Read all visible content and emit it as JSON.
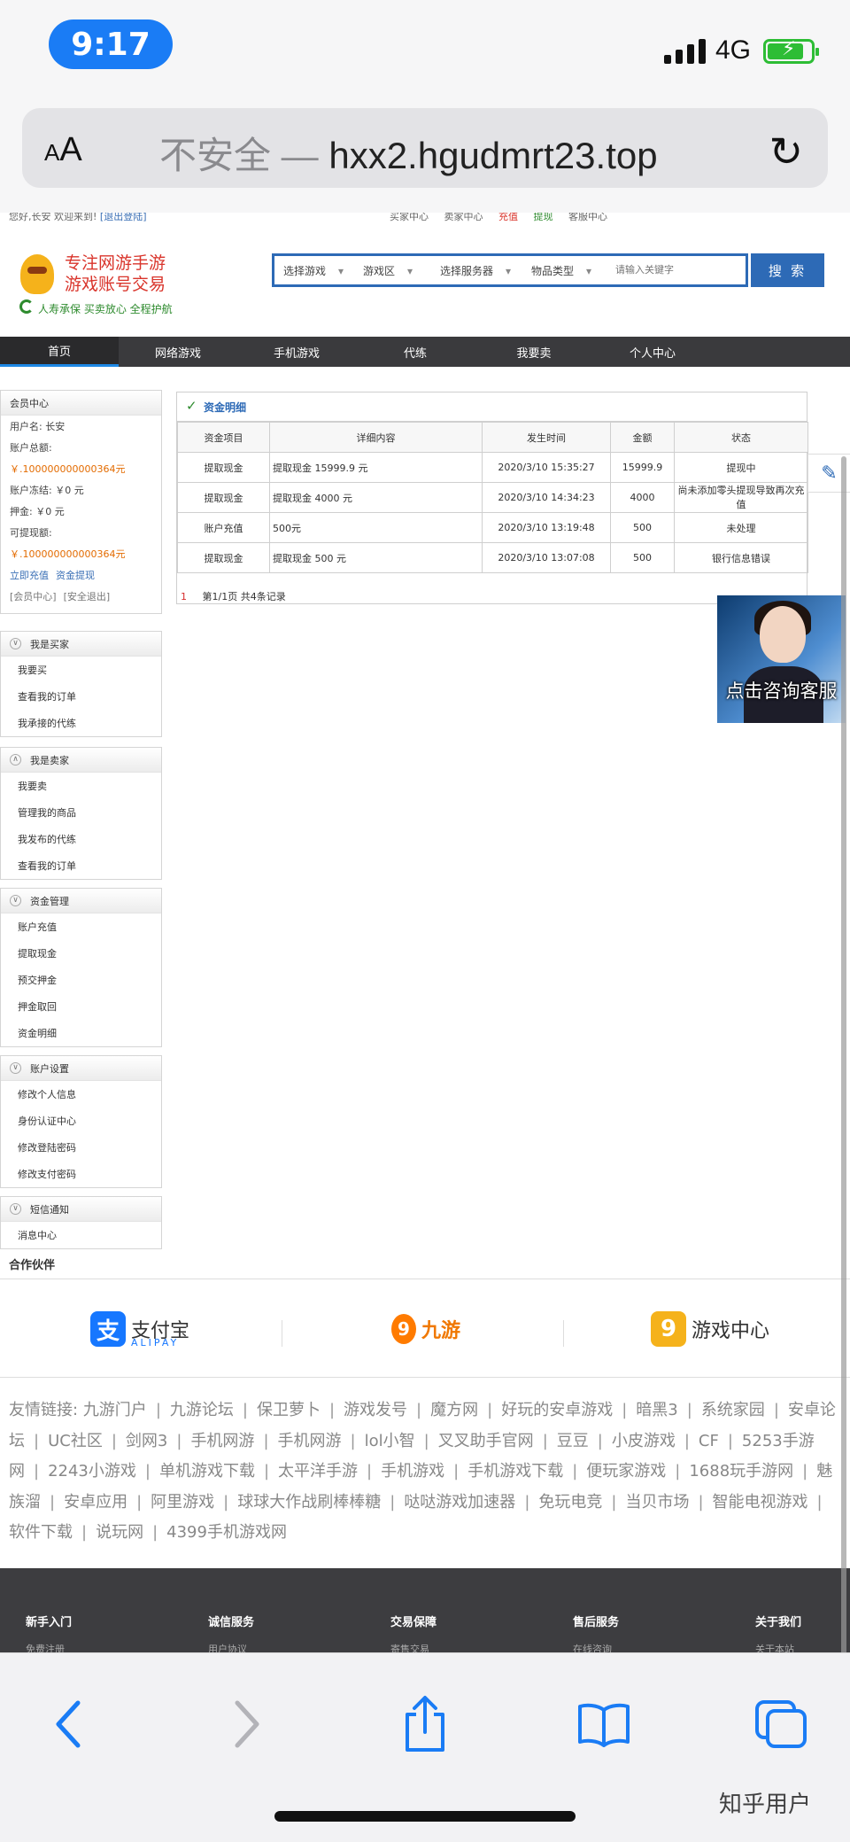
{
  "status_bar": {
    "time": "9:17",
    "network": "4G"
  },
  "address_bar": {
    "aa": "AA",
    "insecure": "不安全 —",
    "domain": "hxx2.hgudmrt23.top"
  },
  "site": {
    "topbar": {
      "greeting": "您好,长安 欢迎来到!",
      "logout": "[退出登陆]",
      "links": [
        "买家中心",
        "卖家中心",
        "充值",
        "提现",
        "客服中心"
      ]
    },
    "logo": {
      "line1": "专注网游手游",
      "line2": "游戏账号交易",
      "slogan": "人寿承保  买卖放心  全程护航"
    },
    "search": {
      "selects": [
        "选择游戏",
        "游戏区",
        "选择服务器",
        "物品类型"
      ],
      "placeholder": "请输入关键字",
      "button": "搜 索"
    },
    "nav": [
      "首页",
      "网络游戏",
      "手机游戏",
      "代练",
      "我要卖",
      "个人中心"
    ],
    "member": {
      "title": "会员中心",
      "username": "用户名: 长安",
      "balance_label": "账户总额:",
      "balance_value": "￥.100000000000364元",
      "frozen": "账户冻结: ￥0 元",
      "deposit": "押金: ￥0 元",
      "withdrawable_label": "可提现额:",
      "withdrawable_value": "￥.100000000000364元",
      "recharge": "立即充值",
      "withdraw": "资金提现",
      "member_center": "[会员中心]",
      "safe_exit": "[安全退出]"
    },
    "panels": [
      {
        "title": "我是买家",
        "items": [
          "我要买",
          "查看我的订单",
          "我承接的代练"
        ]
      },
      {
        "title": "我是卖家",
        "items": [
          "我要卖",
          "管理我的商品",
          "我发布的代练",
          "查看我的订单"
        ]
      },
      {
        "title": "资金管理",
        "items": [
          "账户充值",
          "提取现金",
          "预交押金",
          "押金取回",
          "资金明细"
        ]
      },
      {
        "title": "账户设置",
        "items": [
          "修改个人信息",
          "身份认证中心",
          "修改登陆密码",
          "修改支付密码"
        ]
      },
      {
        "title": "短信通知",
        "items": [
          "消息中心"
        ]
      }
    ],
    "detail": {
      "title": "资金明细",
      "columns": [
        "资金项目",
        "详细内容",
        "发生时间",
        "金额",
        "状态"
      ],
      "rows": [
        [
          "提取现金",
          "提取现金 15999.9 元",
          "2020/3/10 15:35:27",
          "15999.9",
          "提现中"
        ],
        [
          "提取现金",
          "提取现金 4000 元",
          "2020/3/10 14:34:23",
          "4000",
          "尚未添加零头提现导致再次充值"
        ],
        [
          "账户充值",
          "500元",
          "2020/3/10 13:19:48",
          "500",
          "未处理"
        ],
        [
          "提取现金",
          "提取现金 500 元",
          "2020/3/10 13:07:08",
          "500",
          "银行信息错误"
        ]
      ],
      "pager_current": "1",
      "pager_text": "第1/1页 共4条记录"
    },
    "cs_float": "点击咨询客服",
    "partners": {
      "title": "合作伙伴",
      "items": [
        {
          "name": "支付宝",
          "sub": "ALIPAY"
        },
        {
          "name": "九游"
        },
        {
          "name": "游戏中心"
        }
      ]
    },
    "friends": {
      "label": "友情链接:",
      "links": [
        "九游门户",
        "九游论坛",
        "保卫萝卜",
        "游戏发号",
        "魔方网",
        "好玩的安卓游戏",
        "暗黑3",
        "系统家园",
        "安卓论坛",
        "UC社区",
        "剑网3",
        "手机网游",
        "手机网游",
        "lol小智",
        "叉叉助手官网",
        "豆豆",
        "小皮游戏",
        "CF",
        "5253手游网",
        "2243小游戏",
        "单机游戏下载",
        "太平洋手游",
        "手机游戏",
        "手机游戏下载",
        "便玩家游戏",
        "1688玩手游网",
        "魅族溜",
        "安卓应用",
        "阿里游戏",
        "球球大作战刷棒棒糖",
        "哒哒游戏加速器",
        "免玩电竞",
        "当贝市场",
        "智能电视游戏",
        "软件下载",
        "说玩网",
        "4399手机游戏网"
      ]
    },
    "footer": [
      {
        "title": "新手入门",
        "sub": "免费注册"
      },
      {
        "title": "诚信服务",
        "sub": "用户协议"
      },
      {
        "title": "交易保障",
        "sub": "寄售交易"
      },
      {
        "title": "售后服务",
        "sub": "在线咨询"
      },
      {
        "title": "关于我们",
        "sub": "关于本站"
      }
    ]
  },
  "watermark": "知乎用户",
  "icons": {
    "back": "chevron-left-icon",
    "forward": "chevron-right-icon",
    "share": "share-icon",
    "bookmarks": "book-icon",
    "tabs": "tabs-icon",
    "reload": "reload-icon",
    "edit": "pencil-icon"
  },
  "colors": {
    "accent": "#2d6ab6",
    "ios_blue": "#1a7cf5",
    "money": "#e36b00",
    "nav_bg": "#3a3a3d"
  }
}
